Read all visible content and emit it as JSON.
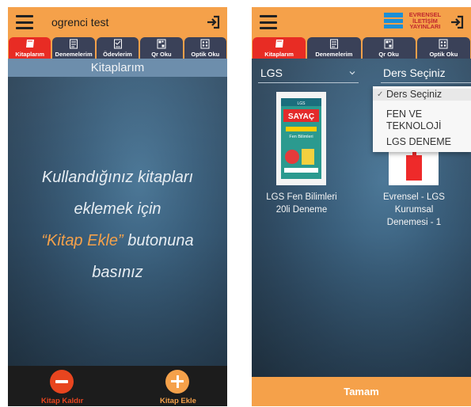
{
  "header": {
    "user_name": "ogrenci test"
  },
  "brand": {
    "logo_text": [
      "EVRENSEL",
      "İLETİŞİM",
      "YAYINLARI"
    ]
  },
  "tabs_left": [
    {
      "label": "Kitaplarım",
      "icon": "book-icon"
    },
    {
      "label": "Denemelerim",
      "icon": "exam-icon"
    },
    {
      "label": "Ödevlerim",
      "icon": "homework-icon"
    },
    {
      "label": "Qr Oku",
      "icon": "qr-icon"
    },
    {
      "label": "Optik Oku",
      "icon": "optic-icon"
    }
  ],
  "tabs_right": [
    {
      "label": "Kitaplarım",
      "icon": "book-icon"
    },
    {
      "label": "Denemelerim",
      "icon": "exam-icon"
    },
    {
      "label": "Qr Oku",
      "icon": "qr-icon"
    },
    {
      "label": "Optik Oku",
      "icon": "optic-icon"
    }
  ],
  "left_screen": {
    "title": "Kitaplarım",
    "empty_msg": {
      "line1": "Kullandığınız kitapları",
      "line2": "eklemek için",
      "highlight": "“Kitap Ekle”",
      "line3_rest": " butonuna",
      "line4": "basınız"
    },
    "remove_label": "Kitap Kaldır",
    "add_label": "Kitap Ekle"
  },
  "right_screen": {
    "level_select": "LGS",
    "course_select": "Ders Seçiniz",
    "dropdown": {
      "options": [
        "Ders Seçiniz",
        "FEN VE TEKNOLOJİ",
        "LGS DENEME"
      ],
      "selected": "Ders Seçiniz",
      "check_mark": "✓"
    },
    "books": [
      {
        "title_line1": "LGS Fen Bilimleri",
        "title_line2": "20li Deneme",
        "cover_brand": "SAYAÇ",
        "cover_subject": "Fen Bilimleri"
      },
      {
        "title_line1": "Evrensel - LGS",
        "title_line2": "Kurumsal",
        "title_line3": "Denemesi - 1"
      }
    ],
    "confirm_label": "Tamam"
  },
  "colors": {
    "accent": "#f5a14a",
    "tab_dark": "#3a4158",
    "tab_active": "#e82c24",
    "remove_red": "#e8451f"
  }
}
